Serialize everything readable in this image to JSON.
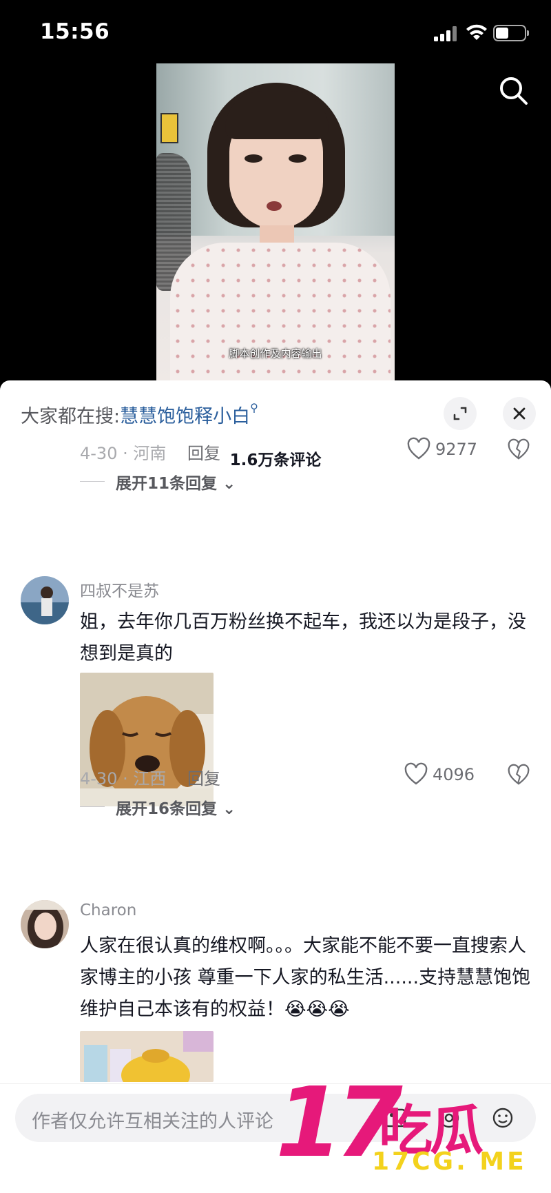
{
  "status_bar": {
    "time": "15:56"
  },
  "video": {
    "caption": "脚本创作及内容输出"
  },
  "comments_sheet": {
    "search_prefix": "大家都在搜:",
    "search_keyword": "慧慧饱饱释小白",
    "comment_count": "1.6万条评论",
    "comments": [
      {
        "date_location": "4-30 · 河南",
        "reply_label": "回复",
        "likes": "9277",
        "expand_label": "展开11条回复"
      },
      {
        "username": "四叔不是苏",
        "text": "姐，去年你几百万粉丝换不起车，我还以为是段子，没想到是真的",
        "date_location": "4-30 · 江西",
        "reply_label": "回复",
        "likes": "4096",
        "expand_label": "展开16条回复"
      },
      {
        "username": "Charon",
        "text": "人家在很认真的维权啊。。。大家能不能不要一直搜索人家博主的小孩 尊重一下人家的私生活......支持慧慧饱饱 维护自己本该有的权益！😭😭😭"
      }
    ]
  },
  "input": {
    "placeholder": "作者仅允许互相关注的人评论"
  },
  "watermark": {
    "logo_number": "17",
    "logo_text": "吃瓜",
    "site": "17CG. ME"
  },
  "colors": {
    "accent_link": "#2a5e9c",
    "watermark_pink": "#e6197a",
    "watermark_yellow": "#f3d21d"
  }
}
